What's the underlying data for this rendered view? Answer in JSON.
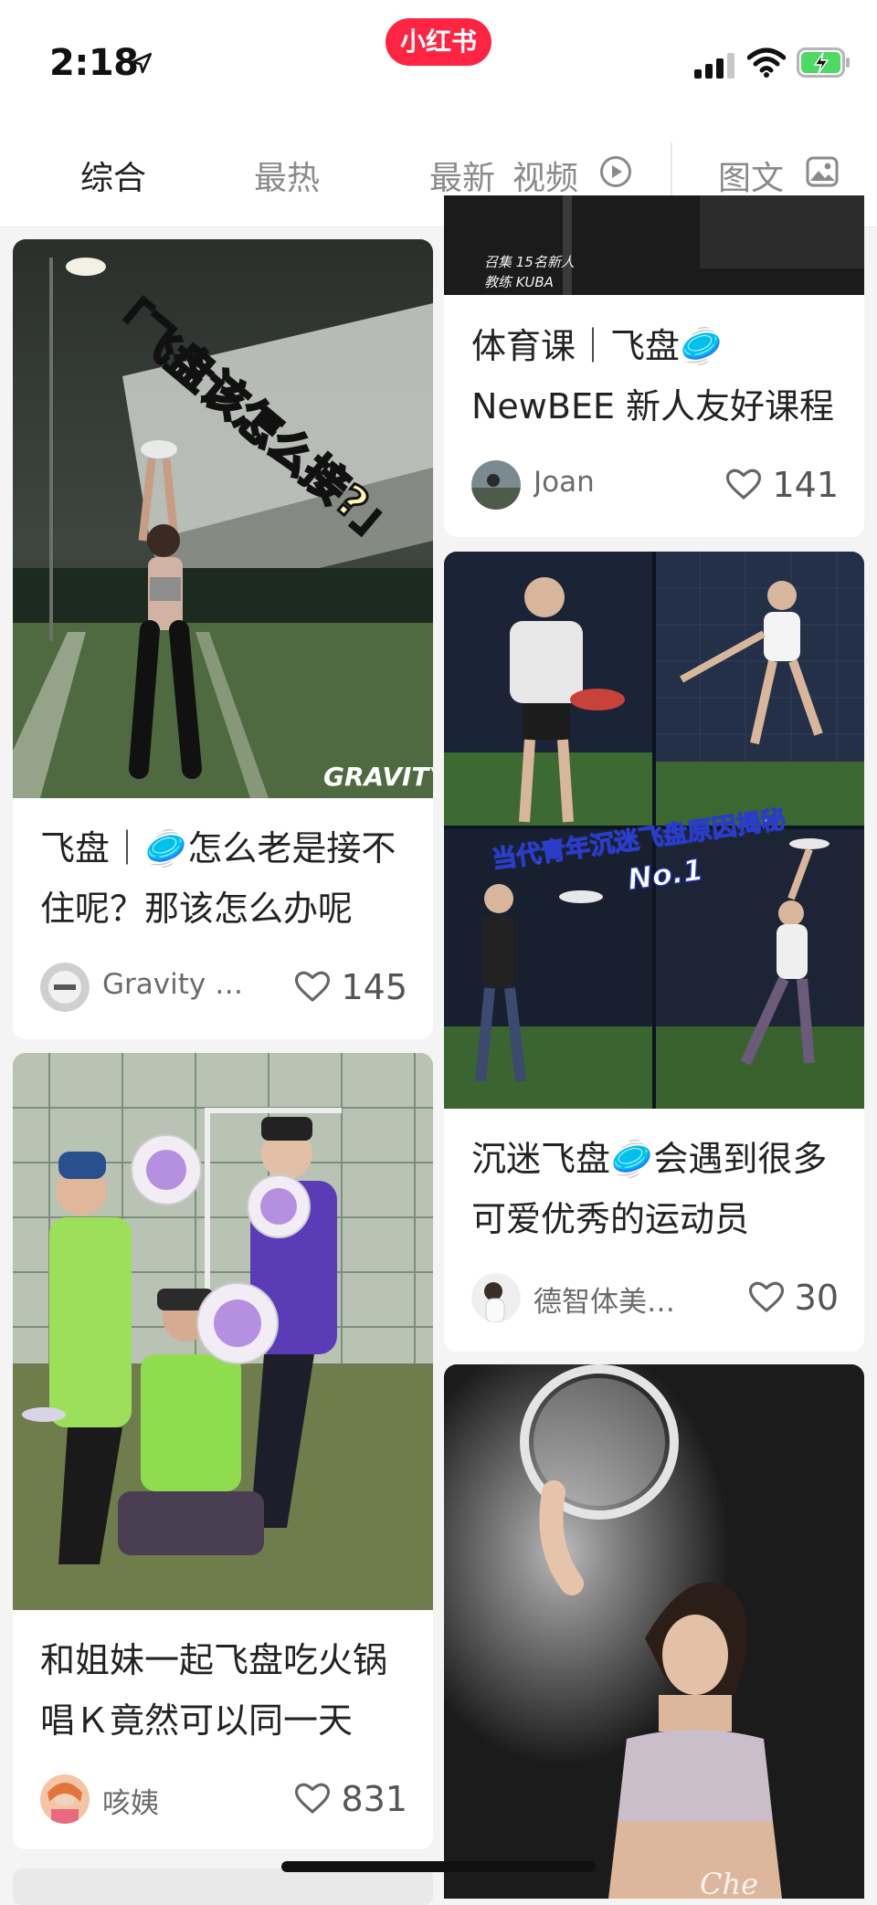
{
  "status": {
    "time": "2:18"
  },
  "app": {
    "badge": "小红书"
  },
  "tabs": [
    {
      "label": "综合"
    },
    {
      "label": "最热"
    },
    {
      "label": "最新"
    },
    {
      "label": "视频"
    },
    {
      "label": "图文"
    }
  ],
  "feed": {
    "left": [
      {
        "cover_text": "「飞盘该怎么接?」",
        "watermark": "GRAVITY",
        "title": "飞盘｜🥏怎么老是接不住呢？那该怎么办呢",
        "author": "Gravity …",
        "likes": "145"
      },
      {
        "title": "和姐妹一起飞盘吃火锅唱Ｋ竟然可以同一天",
        "author": "咳姨",
        "likes": "831"
      }
    ],
    "right": [
      {
        "cover_text_1": "召集 15名新人",
        "cover_text_2": "教练 KUBA",
        "title": "体育课｜飞盘🥏NewBEE 新人友好课程",
        "author": "Joan",
        "likes": "141"
      },
      {
        "cover_text": "当代青年沉迷飞盘原因揭秘",
        "cover_sub": "No.1",
        "title": "沉迷飞盘🥏会遇到很多可爱优秀的运动员",
        "author": "德智体美…",
        "likes": "30"
      },
      {
        "watermark": "Che"
      }
    ]
  },
  "colors": {
    "brand": "#ff2442",
    "battery": "#4cd964"
  }
}
